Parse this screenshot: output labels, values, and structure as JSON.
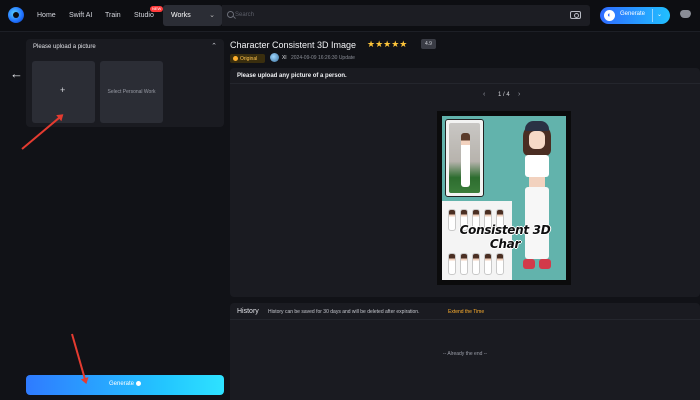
{
  "nav": {
    "items": [
      "Home",
      "Swift AI",
      "Train",
      "Studio"
    ],
    "studio_badge": "NEW",
    "works_label": "Works",
    "search_placeholder": "Search",
    "generate_label": "Generate"
  },
  "left_panel": {
    "upload_title": "Please upload a picture",
    "upload_plus": "+",
    "personal_work_label": "Select Personal Work",
    "generate_label": "Generate"
  },
  "header": {
    "title": "Character Consistent 3D Image",
    "stars": "★★★★★",
    "rating": "4.9",
    "original_badge": "Original",
    "author": "Xl",
    "date": "2024-09-09 16:26:30 Update"
  },
  "preview": {
    "prompt": "Please upload any picture of a person.",
    "pager": "1 / 4",
    "image_caption": "Consistent 3D Char"
  },
  "history": {
    "title": "History",
    "note": "History can be saved for 30 days and will be deleted after expiration.",
    "link": "Extend the Time",
    "end_text": "-- Already the end --"
  },
  "colors": {
    "accent": "#2f7bff",
    "accent_end": "#23c6ff",
    "star": "#ffc53a",
    "warning": "#ffb02e",
    "annotation": "#e43b30"
  },
  "icons": [
    "logo-icon",
    "chevron-down-icon",
    "search-icon",
    "camera-icon",
    "discord-icon",
    "back-arrow-icon",
    "chevron-up-icon",
    "info-icon",
    "prev-icon",
    "next-icon"
  ]
}
